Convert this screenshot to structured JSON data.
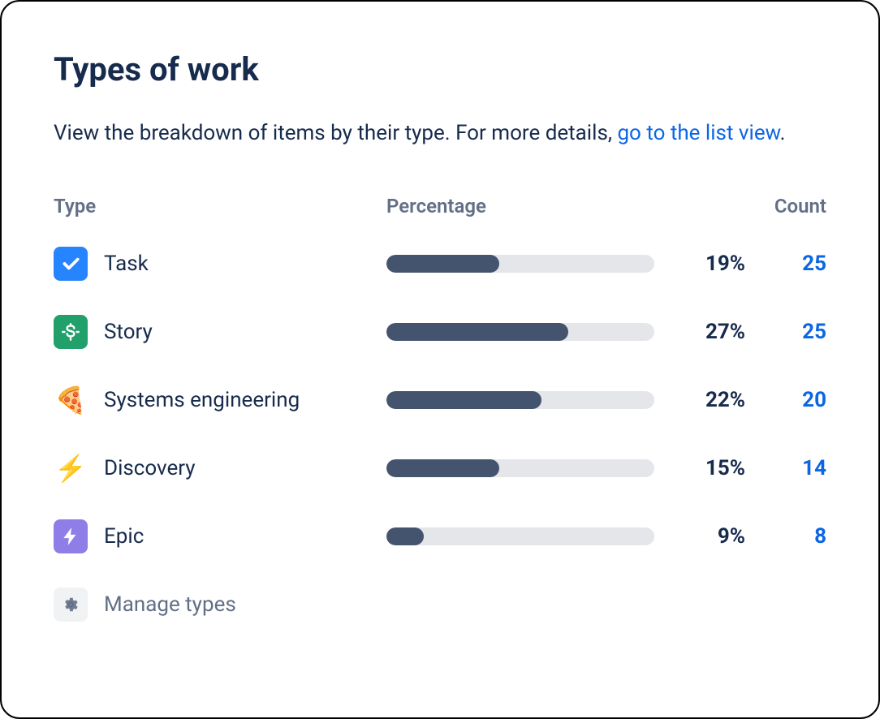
{
  "title": "Types of work",
  "description_prefix": "View the breakdown of items by their type. For more details, ",
  "description_link": "go to the list view",
  "description_suffix": ".",
  "headers": {
    "type": "Type",
    "percentage": "Percentage",
    "count": "Count"
  },
  "rows": [
    {
      "icon": "task",
      "label": "Task",
      "percentage": 19,
      "percentage_label": "19%",
      "bar_pct": 42,
      "count": 25
    },
    {
      "icon": "story",
      "label": "Story",
      "percentage": 27,
      "percentage_label": "27%",
      "bar_pct": 68,
      "count": 25
    },
    {
      "icon": "pizza",
      "label": "Systems engineering",
      "percentage": 22,
      "percentage_label": "22%",
      "bar_pct": 58,
      "count": 20
    },
    {
      "icon": "bolt",
      "label": "Discovery",
      "percentage": 15,
      "percentage_label": "15%",
      "bar_pct": 42,
      "count": 14
    },
    {
      "icon": "epic",
      "label": "Epic",
      "percentage": 9,
      "percentage_label": "9%",
      "bar_pct": 14,
      "count": 8
    }
  ],
  "manage_label": "Manage types",
  "colors": {
    "task_bg": "#2684FF",
    "story_bg": "#22A06B",
    "epic_bg": "#8F7EE7",
    "bar_fill": "#44546F",
    "bar_track": "#E4E6EA",
    "link": "#0C66E4"
  },
  "chart_data": {
    "type": "bar",
    "title": "Types of work",
    "categories": [
      "Task",
      "Story",
      "Systems engineering",
      "Discovery",
      "Epic"
    ],
    "series": [
      {
        "name": "Percentage",
        "values": [
          19,
          27,
          22,
          15,
          9
        ]
      },
      {
        "name": "Count",
        "values": [
          25,
          25,
          20,
          14,
          8
        ]
      }
    ],
    "xlabel": "Type",
    "ylabel": "Percentage"
  }
}
